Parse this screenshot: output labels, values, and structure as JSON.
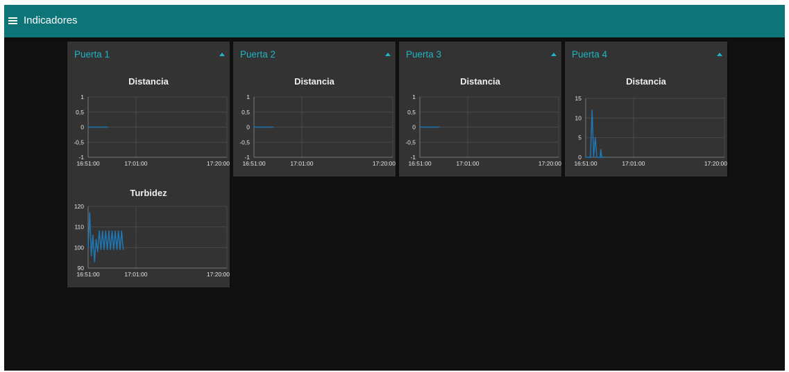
{
  "app": {
    "title": "Indicadores",
    "menu_icon": "hamburger-menu-icon"
  },
  "colors": {
    "toolbar": "#0d7477",
    "background": "#111111",
    "group_background": "#333333",
    "group_title": "#1fb4c4",
    "series": "#1f77b4"
  },
  "groups": [
    {
      "title": "Puerta 1"
    },
    {
      "title": "Puerta 2"
    },
    {
      "title": "Puerta 3"
    },
    {
      "title": "Puerta 4"
    }
  ],
  "chart_data": [
    {
      "type": "line",
      "title": "Distancia",
      "group": "Puerta 1",
      "x_ticks": [
        "16:51:00",
        "17:01:00",
        "17:20:00"
      ],
      "y_ticks": [
        "1",
        "0,5",
        "0",
        "-0,5",
        "-1"
      ],
      "ylim": [
        -1,
        1
      ],
      "grid": true,
      "series": [
        {
          "points": [
            [
              "16:51:00",
              0
            ],
            [
              "16:55:00",
              0
            ]
          ]
        }
      ]
    },
    {
      "type": "line",
      "title": "Distancia",
      "group": "Puerta 2",
      "x_ticks": [
        "16:51:00",
        "17:01:00",
        "17:20:00"
      ],
      "y_ticks": [
        "1",
        "0,5",
        "0",
        "-0,5",
        "-1"
      ],
      "ylim": [
        -1,
        1
      ],
      "grid": true,
      "series": [
        {
          "points": [
            [
              "16:51:00",
              0
            ],
            [
              "16:55:00",
              0
            ]
          ]
        }
      ]
    },
    {
      "type": "line",
      "title": "Distancia",
      "group": "Puerta 3",
      "x_ticks": [
        "16:51:00",
        "17:01:00",
        "17:20:00"
      ],
      "y_ticks": [
        "1",
        "0,5",
        "0",
        "-0,5",
        "-1"
      ],
      "ylim": [
        -1,
        1
      ],
      "grid": true,
      "series": [
        {
          "points": [
            [
              "16:51:00",
              0
            ],
            [
              "16:55:00",
              0
            ]
          ]
        }
      ]
    },
    {
      "type": "line",
      "title": "Distancia",
      "group": "Puerta 4",
      "x_ticks": [
        "16:51:00",
        "17:01:00",
        "17:20:00"
      ],
      "y_ticks": [
        "15",
        "10",
        "5",
        "0"
      ],
      "ylim": [
        0,
        15
      ],
      "grid": true,
      "series": [
        {
          "points": [
            [
              "16:51:00",
              0
            ],
            [
              "16:52:00",
              0
            ],
            [
              "16:52:20",
              12
            ],
            [
              "16:52:40",
              0
            ],
            [
              "16:53:00",
              5
            ],
            [
              "16:53:20",
              0
            ],
            [
              "16:54:00",
              0
            ],
            [
              "16:54:10",
              2
            ],
            [
              "16:54:20",
              0
            ],
            [
              "16:55:00",
              0
            ]
          ]
        }
      ]
    },
    {
      "type": "line",
      "title": "Turbidez",
      "group": "Puerta 1",
      "x_ticks": [
        "16:51:00",
        "17:01:00",
        "17:20:00"
      ],
      "y_ticks": [
        "120",
        "110",
        "100",
        "90"
      ],
      "ylim": [
        90,
        120
      ],
      "grid": true,
      "series": [
        {
          "points": [
            [
              "16:51:00",
              100
            ],
            [
              "16:51:20",
              117
            ],
            [
              "16:51:40",
              96
            ],
            [
              "16:52:00",
              106
            ],
            [
              "16:52:20",
              93
            ],
            [
              "16:52:40",
              104
            ],
            [
              "16:53:00",
              98
            ],
            [
              "16:53:20",
              108
            ],
            [
              "16:53:40",
              99
            ],
            [
              "16:54:00",
              108
            ],
            [
              "16:54:20",
              99
            ],
            [
              "16:54:40",
              108
            ],
            [
              "16:55:00",
              99
            ],
            [
              "16:55:20",
              108
            ],
            [
              "16:55:40",
              99
            ],
            [
              "16:56:00",
              108
            ],
            [
              "16:56:20",
              99
            ],
            [
              "16:56:40",
              108
            ],
            [
              "16:57:00",
              99
            ],
            [
              "16:57:20",
              108
            ],
            [
              "16:57:40",
              99
            ],
            [
              "16:58:00",
              108
            ],
            [
              "16:58:20",
              99
            ]
          ]
        }
      ]
    }
  ]
}
